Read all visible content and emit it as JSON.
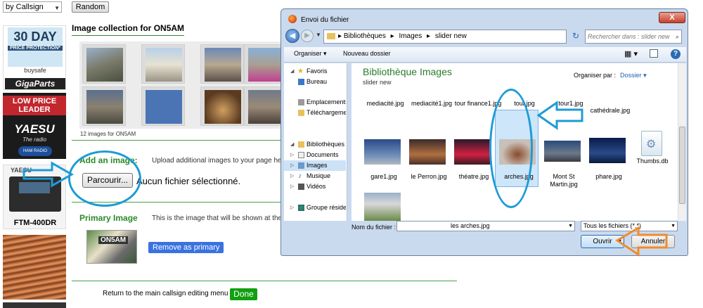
{
  "topbar": {
    "select_value": "by Callsign",
    "random_label": "Random"
  },
  "ads": {
    "ad1_big": "30 DAY",
    "ad1_small": "PRICE PROTECTION*",
    "ad1_buysafe": "buysafe",
    "ad1_brand": "GigaParts",
    "ad2_header": "LOW PRICE LEADER",
    "ad2_brand": "YAESU",
    "ad2_tag": "The radio",
    "ad2_badge": "HAM RADIO OUTLET",
    "ad3_brand": "YAESU",
    "ad3_model": "FTM-400DR"
  },
  "collection": {
    "title": "Image collection for ON5AM",
    "count": "12 images for ON5AM"
  },
  "add": {
    "label": "Add an image:",
    "description": "Upload additional images to your page here.",
    "browse_label": "Parcourir...",
    "no_file": "Aucun fichier sélectionné."
  },
  "primary": {
    "label": "Primary Image",
    "description": "This is the image that will be shown at the to",
    "remove_label": "Remove as primary",
    "sign_text": "ON5AM"
  },
  "footer": {
    "return_text": "Return to the main callsign editing menu",
    "done_label": "Done"
  },
  "dialog": {
    "title": "Envoi du fichier",
    "close_label": "X",
    "breadcrumb": [
      "Bibliothèques",
      "Images",
      "slider new"
    ],
    "search_placeholder": "Rechercher dans : slider new",
    "organize_label": "Organiser",
    "new_folder_label": "Nouveau dossier",
    "help_label": "?",
    "nav_items": [
      {
        "label": "Favoris",
        "icon": "star-icon"
      },
      {
        "label": "Bureau",
        "icon": "desktop-icon"
      },
      {
        "label": "Emplacements",
        "icon": "places-icon"
      },
      {
        "label": "Téléchargements",
        "icon": "download-icon"
      },
      {
        "label": "Bibliothèques",
        "icon": "library-icon"
      },
      {
        "label": "Documents",
        "icon": "documents-icon"
      },
      {
        "label": "Images",
        "icon": "images-icon"
      },
      {
        "label": "Musique",
        "icon": "music-icon"
      },
      {
        "label": "Vidéos",
        "icon": "video-icon"
      },
      {
        "label": "Groupe résidentiel",
        "icon": "homegroup-icon"
      }
    ],
    "library_title": "Bibliothèque Images",
    "library_sub": "slider new",
    "organize_by_label": "Organiser par :",
    "organize_by_value": "Dossier",
    "files_row1": [
      "mediacité.jpg",
      "mediacité1.jpg",
      "tour finance1.jpg",
      "tour.jpg",
      "tour1.jpg",
      "cathédrale.jpg"
    ],
    "files_row2": [
      "gare1.jpg",
      "le Perron.jpg",
      "théatre.jpg",
      "arches.jpg",
      "Mont St Martin.jpg",
      "phare.jpg",
      "Thumbs.db"
    ],
    "filename_label": "Nom du fichier :",
    "filename_value": "les arches.jpg",
    "filter_value": "Tous les fichiers (*.*)",
    "open_label": "Ouvrir",
    "cancel_label": "Annuler"
  },
  "colors": {
    "accent_green": "#2a8a2a",
    "callout_blue": "#1e9bd6",
    "callout_orange": "#f08c2a",
    "remove_blue": "#3a72e0",
    "done_green": "#10a010"
  }
}
